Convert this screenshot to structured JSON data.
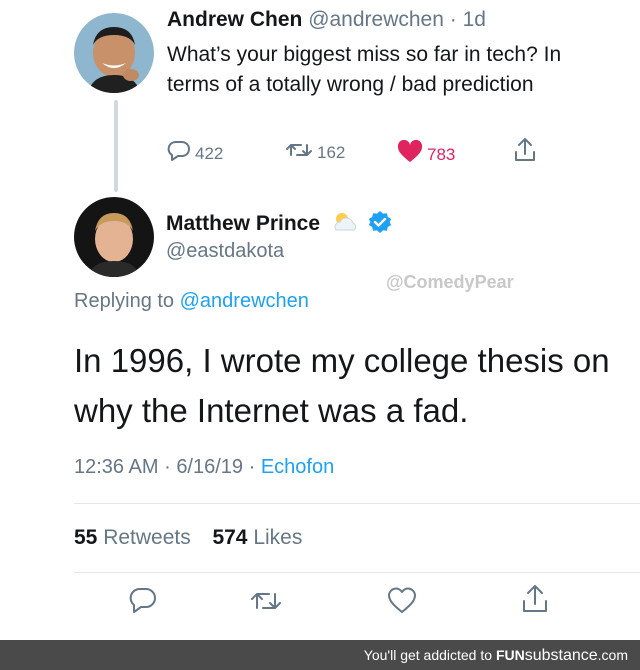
{
  "tweet1": {
    "author_name": "Andrew Chen",
    "author_handle": "@andrewchen",
    "sep": "·",
    "age": "1d",
    "text": "What’s your biggest miss so far in tech? In terms of a totally wrong / bad prediction",
    "replies": "422",
    "retweets": "162",
    "likes": "783"
  },
  "tweet2": {
    "author_name": "Matthew Prince",
    "author_handle": "@eastdakota",
    "watermark": "@ComedyPear",
    "reply_prefix": "Replying to",
    "reply_handle": "@andrewchen",
    "text": "In 1996, I wrote my college thesis on why the Internet was a fad.",
    "time": "12:36 AM",
    "date": "6/16/19",
    "sep": "·",
    "client": "Echofon",
    "retweet_count": "55",
    "retweet_label": "Retweets",
    "like_count": "574",
    "like_label": "Likes"
  },
  "footer": {
    "prefix": "You'll get addicted to",
    "brand_a": "FUN",
    "brand_b": "substance",
    "suffix": ".com"
  },
  "colors": {
    "link": "#1da1f2",
    "secondary": "#657786",
    "like": "#e0245e",
    "verified": "#1da1f2"
  },
  "icons": {
    "reply": "reply-icon",
    "retweet": "retweet-icon",
    "like": "heart-icon",
    "share": "share-icon",
    "verified": "verified-badge-icon",
    "weather": "sun-behind-cloud-emoji"
  }
}
